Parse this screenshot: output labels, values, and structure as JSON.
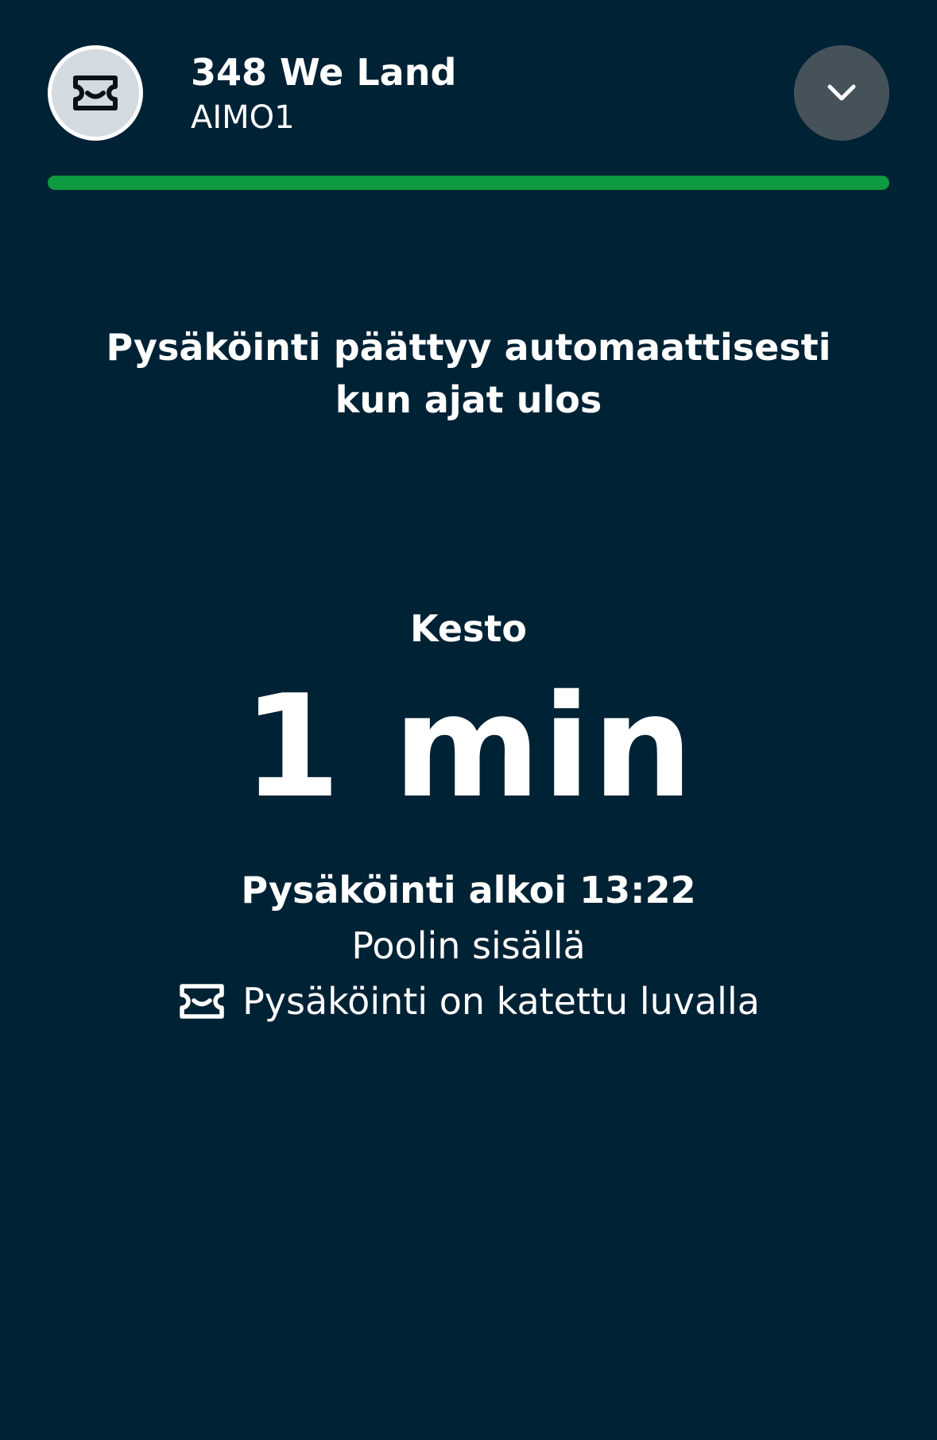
{
  "header": {
    "icon": "ticket-icon",
    "lot_name": "348 We Land",
    "plate": "AIMO1",
    "collapse_icon": "chevron-down-icon"
  },
  "progress": {
    "value": 1.0,
    "color": "#0e9a3e"
  },
  "notice": {
    "line1": "Pysäköinti päättyy automaattisesti",
    "line2": "kun ajat ulos"
  },
  "duration": {
    "label": "Kesto",
    "value": "1 min"
  },
  "details": {
    "start_time": "Pysäköinti alkoi 13:22",
    "pool_status": "Poolin sisällä",
    "permit_icon": "ticket-icon",
    "permit_text": "Pysäköinti on katettu luvalla"
  },
  "colors": {
    "background": "#002235",
    "accent_green": "#0e9a3e",
    "badge_bg": "#d3dbe1",
    "collapse_bg": "#46525a"
  }
}
